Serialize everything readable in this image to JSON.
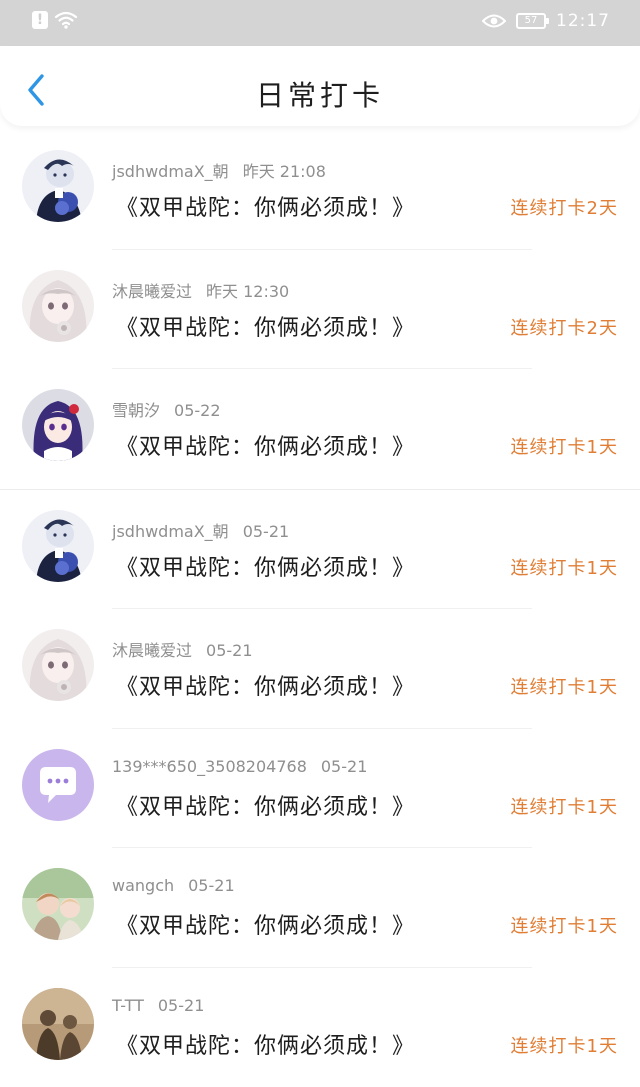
{
  "status_bar": {
    "time": "12:17",
    "battery": "57",
    "icons": [
      "alert-icon",
      "wifi-icon",
      "eye-icon",
      "battery-icon"
    ]
  },
  "header": {
    "title": "日常打卡",
    "back_icon": "chevron-left-icon",
    "accent": "#2f96e6"
  },
  "colors": {
    "streak": "#e07e36",
    "meta": "#8f8f8f"
  },
  "checkins": [
    {
      "name": "jsdhwdmaX_朝",
      "date": "昨天 21:08",
      "message": "《双甲战陀：你俩必须成！》",
      "streak": "连续打卡2天",
      "avatar": "anime-boy-avatar"
    },
    {
      "name": "沐晨曦爱过",
      "date": "昨天 12:30",
      "message": "《双甲战陀：你俩必须成！》",
      "streak": "连续打卡2天",
      "avatar": "anime-girl-white-hair-avatar"
    },
    {
      "name": "雪朝汐",
      "date": "05-22",
      "message": "《双甲战陀：你俩必须成！》",
      "streak": "连续打卡1天",
      "avatar": "anime-girl-purple-hair-avatar"
    },
    {
      "name": "jsdhwdmaX_朝",
      "date": "05-21",
      "message": "《双甲战陀：你俩必须成！》",
      "streak": "连续打卡1天",
      "avatar": "anime-boy-avatar"
    },
    {
      "name": "沐晨曦爱过",
      "date": "05-21",
      "message": "《双甲战陀：你俩必须成！》",
      "streak": "连续打卡1天",
      "avatar": "anime-girl-white-hair-avatar"
    },
    {
      "name": "139***650_3508204768",
      "date": "05-21",
      "message": "《双甲战陀：你俩必须成！》",
      "streak": "连续打卡1天",
      "avatar": "chat-bubble-avatar"
    },
    {
      "name": "wangch",
      "date": "05-21",
      "message": "《双甲战陀：你俩必须成！》",
      "streak": "连续打卡1天",
      "avatar": "photo-couple-avatar"
    },
    {
      "name": "T-TT",
      "date": "05-21",
      "message": "《双甲战陀：你俩必须成！》",
      "streak": "连续打卡1天",
      "avatar": "sepia-silhouette-avatar"
    }
  ]
}
